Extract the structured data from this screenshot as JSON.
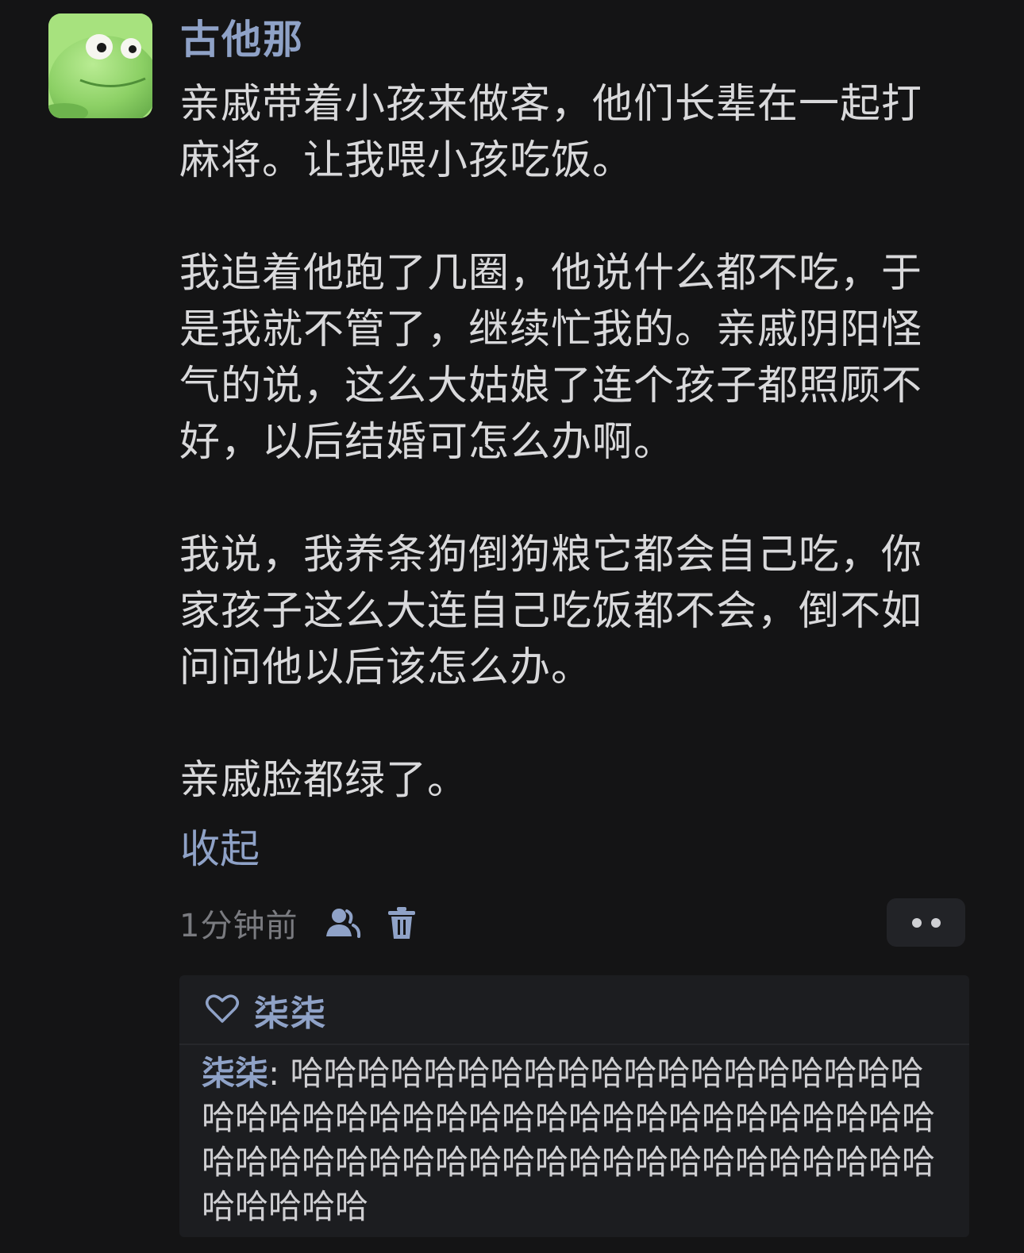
{
  "post": {
    "username": "古他那",
    "paragraphs": [
      "亲戚带着小孩来做客，他们长辈在一起打麻将。让我喂小孩吃饭。",
      "我追着他跑了几圈，他说什么都不吃，于是我就不管了，继续忙我的。亲戚阴阳怪气的说，这么大姑娘了连个孩子都照顾不好，以后结婚可怎么办啊。",
      "我说，我养条狗倒狗粮它都会自己吃，你家孩子这么大连自己吃饭都不会，倒不如问问他以后该怎么办。",
      "亲戚脸都绿了。"
    ],
    "collapse_label": "收起",
    "timestamp": "1分钟前"
  },
  "icons": {
    "avatar": "frog-avatar",
    "user": "user-icon",
    "delete": "trash-icon",
    "more": "more-dots-icon",
    "like": "heart-icon"
  },
  "reply_section": {
    "liked_by": "柒柒",
    "reply": {
      "author": "柒柒",
      "separator": ": ",
      "text": "哈哈哈哈哈哈哈哈哈哈哈哈哈哈哈哈哈哈哈哈哈哈哈哈哈哈哈哈哈哈哈哈哈哈哈哈哈哈哈哈哈哈哈哈哈哈哈哈哈哈哈哈哈哈哈哈哈哈哈哈哈哈哈哈哈哈哈哈"
    }
  },
  "colors": {
    "background": "#141415",
    "accent": "#8fa2c7",
    "text": "#d9d9db",
    "muted": "#7a7b80",
    "reply_bg": "#1c1d20"
  }
}
